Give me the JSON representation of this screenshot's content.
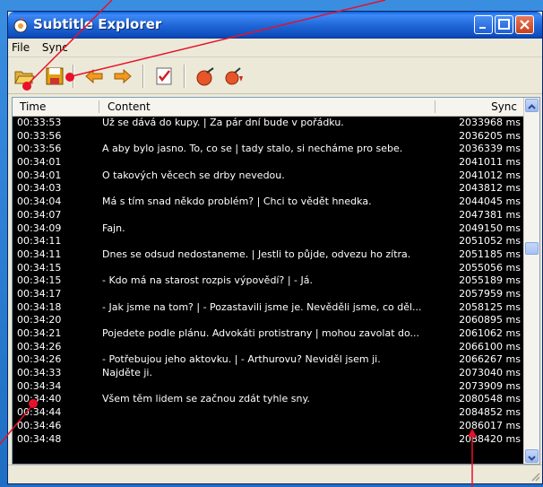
{
  "window": {
    "title": "Subtitle Explorer",
    "accent": "#2167d8"
  },
  "menu": {
    "items": [
      "File",
      "Sync"
    ]
  },
  "toolbar": {
    "icons": [
      "open-folder-icon",
      "save-icon",
      "arrow-left-icon",
      "arrow-right-icon",
      "checklist-icon",
      "sync-ball-icon",
      "sync-ball-down-icon"
    ]
  },
  "list": {
    "headers": {
      "time": "Time",
      "content": "Content",
      "sync": "Sync"
    },
    "rows": [
      {
        "time": "00:33:53",
        "content": "Už se dává do kupy. | Za pár dní bude v pořádku.",
        "sync": "2033968 ms"
      },
      {
        "time": "00:33:56",
        "content": "",
        "sync": "2036205 ms"
      },
      {
        "time": "00:33:56",
        "content": "A aby bylo jasno. To, co se | tady stalo, si necháme pro sebe.",
        "sync": "2036339 ms"
      },
      {
        "time": "00:34:01",
        "content": "",
        "sync": "2041011 ms"
      },
      {
        "time": "00:34:01",
        "content": "O takových věcech se drby nevedou.",
        "sync": "2041012 ms"
      },
      {
        "time": "00:34:03",
        "content": "",
        "sync": "2043812 ms"
      },
      {
        "time": "00:34:04",
        "content": "Má s tím snad někdo problém? | Chci to vědět hnedka.",
        "sync": "2044045 ms"
      },
      {
        "time": "00:34:07",
        "content": "",
        "sync": "2047381 ms"
      },
      {
        "time": "00:34:09",
        "content": "Fajn.",
        "sync": "2049150 ms"
      },
      {
        "time": "00:34:11",
        "content": "",
        "sync": "2051052 ms"
      },
      {
        "time": "00:34:11",
        "content": "Dnes se odsud nedostaneme. | Jestli to půjde, odvezu ho zítra.",
        "sync": "2051185 ms"
      },
      {
        "time": "00:34:15",
        "content": "",
        "sync": "2055056 ms"
      },
      {
        "time": "00:34:15",
        "content": "- Kdo má na starost rozpis výpovědí? | - Já.",
        "sync": "2055189 ms"
      },
      {
        "time": "00:34:17",
        "content": "",
        "sync": "2057959 ms"
      },
      {
        "time": "00:34:18",
        "content": "- Jak jsme na tom? | - Pozastavili jsme je. Nevěděli jsme, co děl...",
        "sync": "2058125 ms"
      },
      {
        "time": "00:34:20",
        "content": "",
        "sync": "2060895 ms"
      },
      {
        "time": "00:34:21",
        "content": "Pojedete podle plánu. Advokáti protistrany | mohou zavolat do...",
        "sync": "2061062 ms"
      },
      {
        "time": "00:34:26",
        "content": "",
        "sync": "2066100 ms"
      },
      {
        "time": "00:34:26",
        "content": "- Potřebujou jeho aktovku. | - Arthurovu? Neviděl jsem ji.",
        "sync": "2066267 ms"
      },
      {
        "time": "00:34:33",
        "content": "Najděte ji.",
        "sync": "2073040 ms"
      },
      {
        "time": "00:34:34",
        "content": "",
        "sync": "2073909 ms"
      },
      {
        "time": "00:34:40",
        "content": "Všem těm lidem se začnou zdát tyhle sny.",
        "sync": "2080548 ms"
      },
      {
        "time": "00:34:44",
        "content": "",
        "sync": "2084852 ms"
      },
      {
        "time": "00:34:46",
        "content": "",
        "sync": "2086017 ms"
      },
      {
        "time": "00:34:48",
        "content": "",
        "sync": "2088420 ms"
      }
    ]
  },
  "scroll": {
    "position": 0.4
  },
  "colors": {
    "list_bg": "#000000",
    "list_text": "#ffffff",
    "callout": "#e8102a"
  }
}
